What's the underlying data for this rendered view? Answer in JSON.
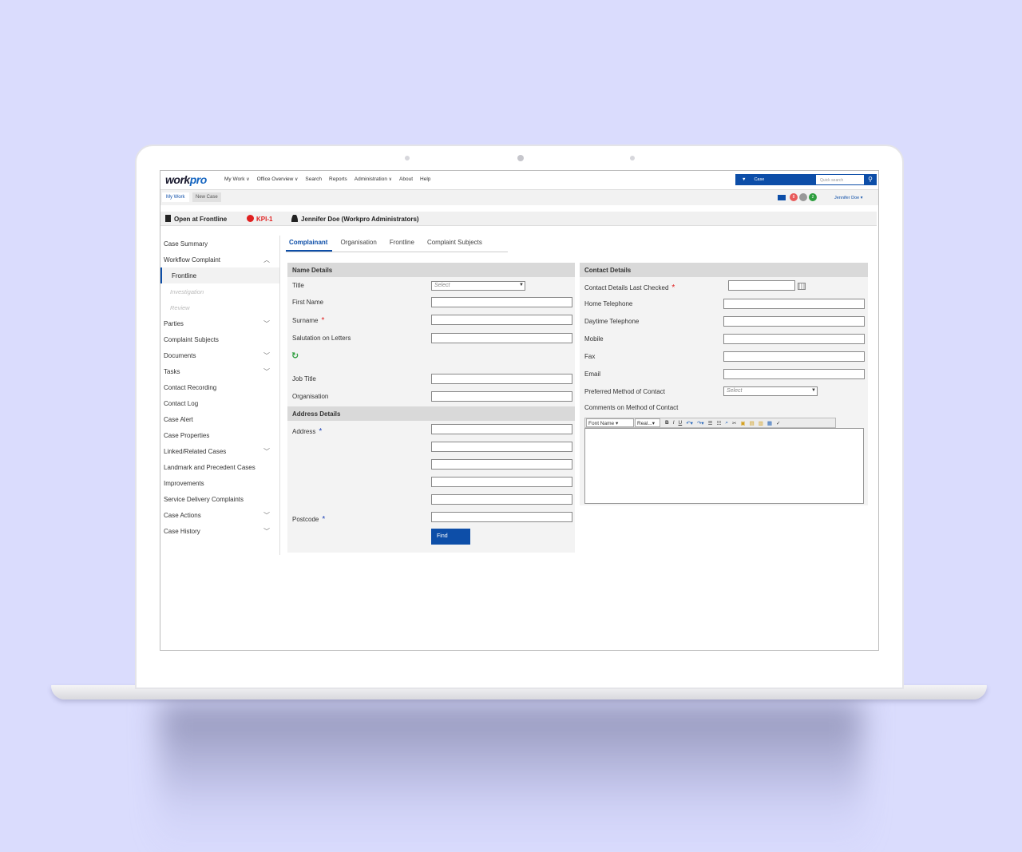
{
  "app": {
    "logo_main": "work",
    "logo_accent": "pro",
    "nav": [
      "My Work",
      "Office Overview",
      "Search",
      "Reports",
      "Administration",
      "About",
      "Help"
    ],
    "search_scope": "Case",
    "quick_search_placeholder": "Quick search",
    "tabs": [
      "My Work",
      "New Case"
    ],
    "notification_counts": [
      "8",
      "",
      "2"
    ],
    "user_menu": "Jennifer Doe"
  },
  "casebar": {
    "status": "Open at Frontline",
    "kpi": "KPI-1",
    "user": "Jennifer Doe (Workpro Administrators)"
  },
  "sidebar": {
    "items": [
      {
        "label": "Case Summary"
      },
      {
        "label": "Workflow Complaint",
        "chevron": "up"
      },
      {
        "label": "Frontline",
        "selected": true
      },
      {
        "label": "Investigation",
        "disabled": true
      },
      {
        "label": "Review",
        "disabled": true
      },
      {
        "label": "Parties",
        "chevron": "down"
      },
      {
        "label": "Complaint Subjects"
      },
      {
        "label": "Documents",
        "chevron": "down"
      },
      {
        "label": "Tasks",
        "chevron": "down"
      },
      {
        "label": "Contact Recording"
      },
      {
        "label": "Contact Log"
      },
      {
        "label": "Case Alert"
      },
      {
        "label": "Case Properties"
      },
      {
        "label": "Linked/Related Cases",
        "chevron": "down"
      },
      {
        "label": "Landmark and Precedent Cases"
      },
      {
        "label": "Improvements"
      },
      {
        "label": "Service Delivery Complaints"
      },
      {
        "label": "Case Actions",
        "chevron": "down"
      },
      {
        "label": "Case History",
        "chevron": "down"
      }
    ]
  },
  "content_tabs": [
    "Complainant",
    "Organisation",
    "Frontline",
    "Complaint Subjects"
  ],
  "name_details": {
    "header": "Name Details",
    "title_label": "Title",
    "title_value": "Select",
    "first_name_label": "First Name",
    "surname_label": "Surname",
    "salutation_label": "Salutation on Letters",
    "job_title_label": "Job Title",
    "organisation_label": "Organisation"
  },
  "address_details": {
    "header": "Address Details",
    "address_label": "Address",
    "postcode_label": "Postcode",
    "find_label": "Find"
  },
  "contact_details": {
    "header": "Contact Details",
    "last_checked_label": "Contact Details Last Checked",
    "home_tel_label": "Home Telephone",
    "day_tel_label": "Daytime Telephone",
    "mobile_label": "Mobile",
    "fax_label": "Fax",
    "email_label": "Email",
    "preferred_label": "Preferred Method of Contact",
    "preferred_value": "Select",
    "comments_label": "Comments on Method of Contact",
    "font_name": "Font Name",
    "font_size": "Real..."
  },
  "colors": {
    "accent": "#0d4ea8",
    "kpi": "#e02020",
    "background": "#dadcfd"
  }
}
